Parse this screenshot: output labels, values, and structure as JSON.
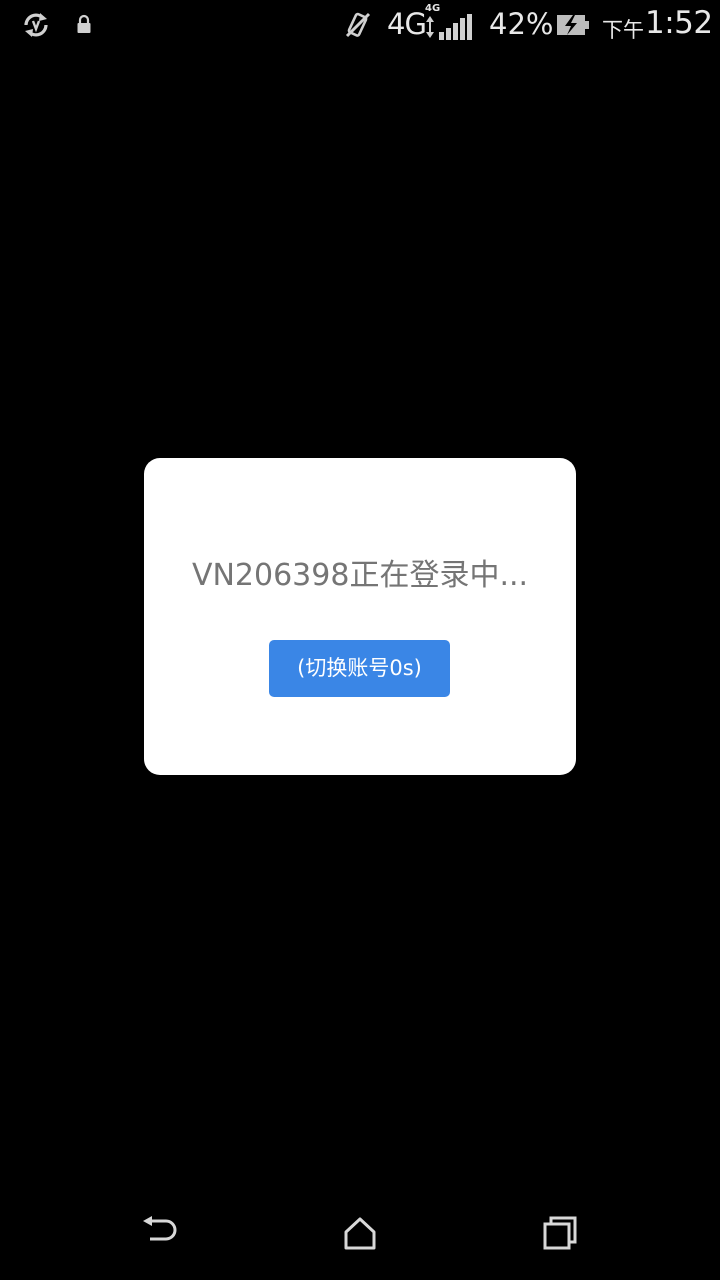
{
  "status_bar": {
    "network": "4G",
    "network_secondary": "4G",
    "battery_percent": "42%",
    "time_period": "下午",
    "time": "1:52",
    "icons": [
      "sync-icon",
      "lock-icon",
      "mute-icon",
      "signal-icon",
      "battery-charging-icon"
    ]
  },
  "dialog": {
    "message": "VN206398正在登录中...",
    "switch_button_label": "(切换账号0s)"
  },
  "nav_bar": {
    "icons": [
      "back-icon",
      "home-icon",
      "recent-apps-icon"
    ]
  },
  "colors": {
    "background": "#000000",
    "dialog_background": "#ffffff",
    "message_text": "#757575",
    "button_accent": "#3a86e6",
    "status_text": "#e8e8e8"
  }
}
